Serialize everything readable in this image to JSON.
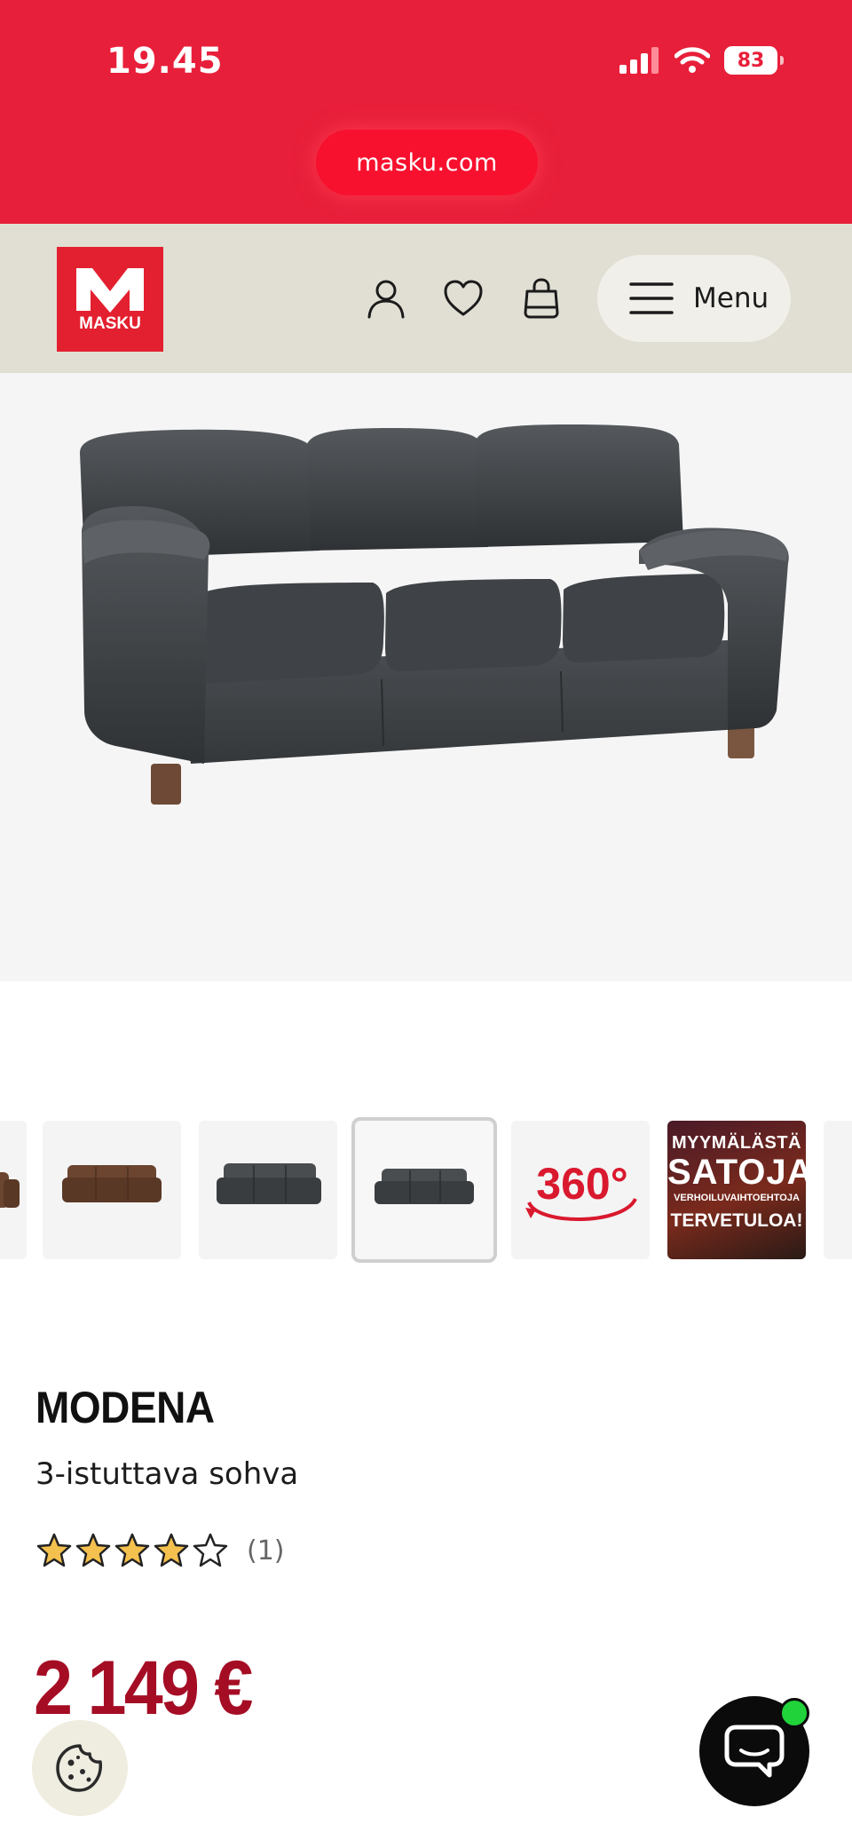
{
  "status_bar": {
    "time": "19.45",
    "battery": "83",
    "url": "masku.com"
  },
  "header": {
    "logo_text": "MASKU",
    "menu_label": "Menu"
  },
  "thumbnails": {
    "promo_line1": "MYYMÄLÄSTÄ",
    "promo_line2": "SATOJA",
    "promo_line3": "VERHOILUVAIHTOEHTOJA",
    "promo_line4": "TERVETULOA!",
    "rotate_label": "360°"
  },
  "product": {
    "name": "MODENA",
    "subtitle": "3-istuttava sohva",
    "rating": 4,
    "rating_max": 5,
    "review_count": "(1)",
    "price": "2 149 €"
  },
  "colors": {
    "brand_red": "#e81f3a",
    "price_red": "#a50d24",
    "header_beige": "#e1dfd4",
    "star_fill": "#f4c04e",
    "chat_badge": "#21d33a"
  },
  "icons": {
    "account": "user-icon",
    "wishlist": "heart-icon",
    "cart": "shopping-bag-icon",
    "menu": "hamburger-icon",
    "cookie": "cookie-icon",
    "chat": "chat-icon"
  }
}
